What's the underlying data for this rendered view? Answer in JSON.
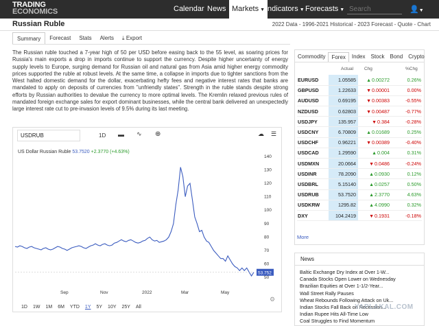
{
  "app": {
    "logo_line1": "TRADING",
    "logo_line2": "ECONOMICS"
  },
  "nav": {
    "items": [
      "Calendar",
      "News",
      "Markets",
      "Indicators",
      "Forecasts"
    ],
    "active": "Markets",
    "search_placeholder": "Search",
    "user_icon": "user-icon"
  },
  "page": {
    "title": "Russian Ruble",
    "crumbs": "2022 Data - 1996-2021 Historical - 2023 Forecast - Quote - Chart"
  },
  "subtabs": [
    "Summary",
    "Forecast",
    "Stats",
    "Alerts",
    "Export"
  ],
  "summary_text": "The Russian ruble touched a 7-year high of 50 per USD before easing back to the 55 level, as soaring prices for Russia's main exports a drop in imports continue to support the currency. Despite higher uncertainty of energy supply levels to Europe, surging demand for Russian oil and natural gas from Asia amid higher energy commodity prices supported the ruble at robust levels. At the same time, a collapse in imports due to tighter sanctions from the West halted domestic demand for the dollar, exacerbating hefty fees and negative interest rates that banks are mandated to apply on deposits of currencies from \"unfriendly states\". Strength in the ruble stands despite strong efforts by Russian authorities to devalue the currency to more optimal levels. The Kremlin relaxed previous rules of mandated foreign exchange sales for export dominant businesses, while the central bank delivered an unexpectedly large interest rate cut to pre-invasion levels of 9.5% during its last meeting.",
  "chart": {
    "symbol": "USDRUB",
    "interval": "1D",
    "legend_name": "US Dollar Russian Ruble",
    "legend_value": "53.7520",
    "legend_change": "+2.3770 (+4.63%)",
    "last_label": "53.752",
    "ranges": [
      "1D",
      "1W",
      "1M",
      "6M",
      "YTD",
      "1Y",
      "5Y",
      "10Y",
      "25Y",
      "All"
    ],
    "active_range": "1Y"
  },
  "chart_data": {
    "type": "line",
    "title": "",
    "series": [
      {
        "name": "US Dollar Russian Ruble",
        "values": [
          73,
          72.5,
          73.5,
          73,
          72,
          71.5,
          72.5,
          73,
          72,
          71.5,
          71,
          70.5,
          71.5,
          72,
          71,
          70.5,
          71,
          72,
          73,
          72.5,
          71.5,
          71,
          70,
          71,
          72,
          72.5,
          73,
          73.5,
          73,
          72,
          71.5,
          72.5,
          73.5,
          74,
          75,
          74,
          73.5,
          74.5,
          75,
          74,
          73.5,
          74,
          75.5,
          76,
          77,
          78,
          77,
          76.5,
          77.5,
          78,
          77,
          76,
          75.5,
          76,
          77,
          77.5,
          79,
          80,
          78,
          77,
          77.5,
          76,
          76.5,
          77,
          78,
          80,
          84,
          90,
          104,
          115,
          132,
          125,
          110,
          118,
          120,
          108,
          95,
          90,
          84,
          85,
          80,
          77,
          76,
          73,
          70,
          68,
          66,
          64,
          64,
          62,
          66,
          63,
          60,
          58,
          57,
          55,
          57,
          55,
          57,
          54,
          51,
          53.752
        ]
      }
    ],
    "x_tick_labels": [
      "Sep",
      "Nov",
      "2022",
      "Mar",
      "May"
    ],
    "y_ticks": [
      50,
      60,
      70,
      80,
      90,
      100,
      110,
      120,
      130,
      140
    ],
    "ylim": [
      48,
      142
    ],
    "last_value": 53.752,
    "grid": false,
    "color": "#3a5bbf"
  },
  "quotes": {
    "tabs": [
      "Commodity",
      "Forex",
      "Index",
      "Stock",
      "Bond",
      "Crypto"
    ],
    "active_tab": "Forex",
    "col_actual": "Actual",
    "col_chg": "Chg",
    "col_pct": "%Chg",
    "rows": [
      {
        "sym": "EURUSD",
        "actual": "1.05585",
        "chg": "0.00272",
        "pct": "0.26%",
        "dir": "up"
      },
      {
        "sym": "GBPUSD",
        "actual": "1.22633",
        "chg": "0.00001",
        "pct": "0.00%",
        "dir": "dn"
      },
      {
        "sym": "AUDUSD",
        "actual": "0.69195",
        "chg": "0.00383",
        "pct": "-0.55%",
        "dir": "dn"
      },
      {
        "sym": "NZDUSD",
        "actual": "0.62803",
        "chg": "0.00487",
        "pct": "-0.77%",
        "dir": "dn"
      },
      {
        "sym": "USDJPY",
        "actual": "135.957",
        "chg": "0.384",
        "pct": "-0.28%",
        "dir": "dn"
      },
      {
        "sym": "USDCNY",
        "actual": "6.70809",
        "chg": "0.01689",
        "pct": "0.25%",
        "dir": "up"
      },
      {
        "sym": "USDCHF",
        "actual": "0.96221",
        "chg": "0.00389",
        "pct": "-0.40%",
        "dir": "dn"
      },
      {
        "sym": "USDCAD",
        "actual": "1.29590",
        "chg": "0.004",
        "pct": "0.31%",
        "dir": "up"
      },
      {
        "sym": "USDMXN",
        "actual": "20.0664",
        "chg": "0.0486",
        "pct": "-0.24%",
        "dir": "dn"
      },
      {
        "sym": "USDINR",
        "actual": "78.2090",
        "chg": "0.0930",
        "pct": "0.12%",
        "dir": "up"
      },
      {
        "sym": "USDBRL",
        "actual": "5.15140",
        "chg": "0.0257",
        "pct": "0.50%",
        "dir": "up"
      },
      {
        "sym": "USDRUB",
        "actual": "53.7520",
        "chg": "2.3770",
        "pct": "4.63%",
        "dir": "up"
      },
      {
        "sym": "USDKRW",
        "actual": "1295.82",
        "chg": "4.0990",
        "pct": "0.32%",
        "dir": "up"
      },
      {
        "sym": "DXY",
        "actual": "104.2419",
        "chg": "0.1931",
        "pct": "-0.18%",
        "dir": "dn"
      }
    ],
    "more": "More"
  },
  "news": {
    "heading": "News",
    "items": [
      "Baltic Exchange Dry Index at Over 1-W...",
      "Canada Stocks Open Lower on Wednesday",
      "Brazilian Equities at Over 1-1/2-Year...",
      "Wall Street Rally Pauses",
      "Wheat Rebounds Following Attack on Uk...",
      "Indian Stocks Fall Back on Recession...",
      "Indian Rupee Hits All-Time Low",
      "Coal Struggles to Find Momentum"
    ]
  },
  "watermark": "YAPLAKAL.COM"
}
